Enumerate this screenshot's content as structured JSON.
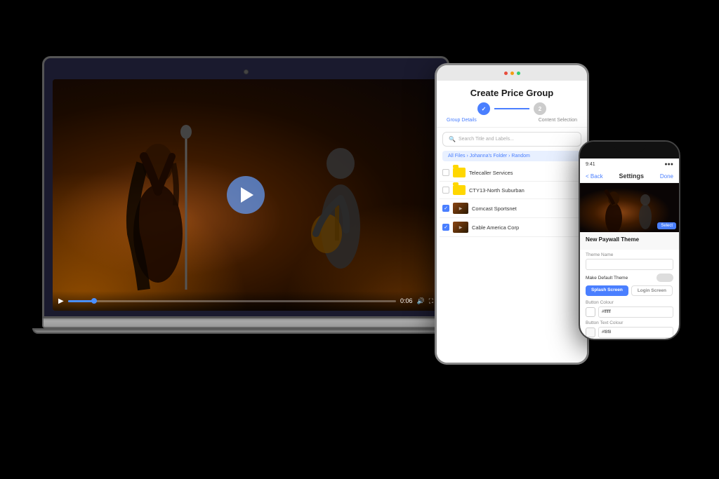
{
  "background": "#000000",
  "laptop": {
    "screen": {
      "concert_description": "Female singer at microphone with guitarist in background, warm orange stage lighting"
    },
    "controls": {
      "time": "0:06",
      "play_label": "▶"
    }
  },
  "tablet": {
    "title": "Create Price Group",
    "steps": [
      {
        "label": "Group Details",
        "number": "1",
        "active": true
      },
      {
        "label": "Content Selection",
        "number": "2",
        "active": false
      }
    ],
    "search_placeholder": "Search Title and Labels...",
    "breadcrumb": "All Files › Johanna's Folder › Random",
    "files": [
      {
        "name": "Telecaller Services",
        "type": "folder",
        "checked": false
      },
      {
        "name": "CTY13-North Suburban",
        "type": "folder",
        "checked": false
      },
      {
        "name": "Comcast Sportsnet",
        "type": "video",
        "checked": true
      },
      {
        "name": "Cable America Corp",
        "type": "video",
        "checked": true
      }
    ]
  },
  "phone": {
    "status": {
      "time": "9:41",
      "signal": "●●●",
      "battery": "■"
    },
    "header": {
      "back": "< Back",
      "title": "Settings",
      "action": "Done"
    },
    "section_title": "New Paywall Theme",
    "form": {
      "theme_name_label": "Theme Name",
      "theme_name_placeholder": "",
      "default_toggle_label": "Make Default Theme",
      "tabs": [
        "Splash Screen",
        "Login Screen"
      ],
      "button_color_label": "Button Colour",
      "button_color_value": "#ffffff",
      "button_text_color_label": "Button Text Colour",
      "button_text_color_value": "#f8f8"
    }
  }
}
